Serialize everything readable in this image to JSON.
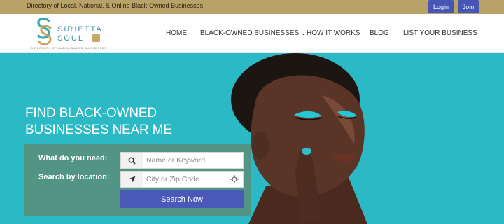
{
  "topbar": {
    "tagline": "Directory of Local, National, & Online Black-Owned Businesses",
    "login_label": "Login",
    "join_label": "Join"
  },
  "logo": {
    "name_line1": "SIRIETTA",
    "name_line2": "SOUL",
    "subtitle": "DIRECTORY OF BLACK-OWNED BUSINESSES"
  },
  "nav": {
    "items": [
      {
        "label": "HOME"
      },
      {
        "label": "BLACK-OWNED BUSINESSES"
      },
      {
        "label": "HOW IT WORKS"
      },
      {
        "label": "BLOG"
      },
      {
        "label": "LIST YOUR BUSINESS"
      }
    ]
  },
  "hero": {
    "title_line1": "FIND BLACK-OWNED",
    "title_line2": "BUSINESSES NEAR ME"
  },
  "search": {
    "need_label": "What do you need:",
    "location_label": "Search by location:",
    "keyword_placeholder": "Name or Keyword",
    "location_placeholder": "City or Zip Code",
    "button_label": "Search Now"
  },
  "colors": {
    "topbar": "#b9a267",
    "hero_bg": "#2bbac5",
    "button": "#4556b4",
    "panel": "#5c8c76"
  },
  "icons": [
    "search-icon",
    "location-arrow-icon",
    "crosshair-icon",
    "chevron-down-icon"
  ]
}
